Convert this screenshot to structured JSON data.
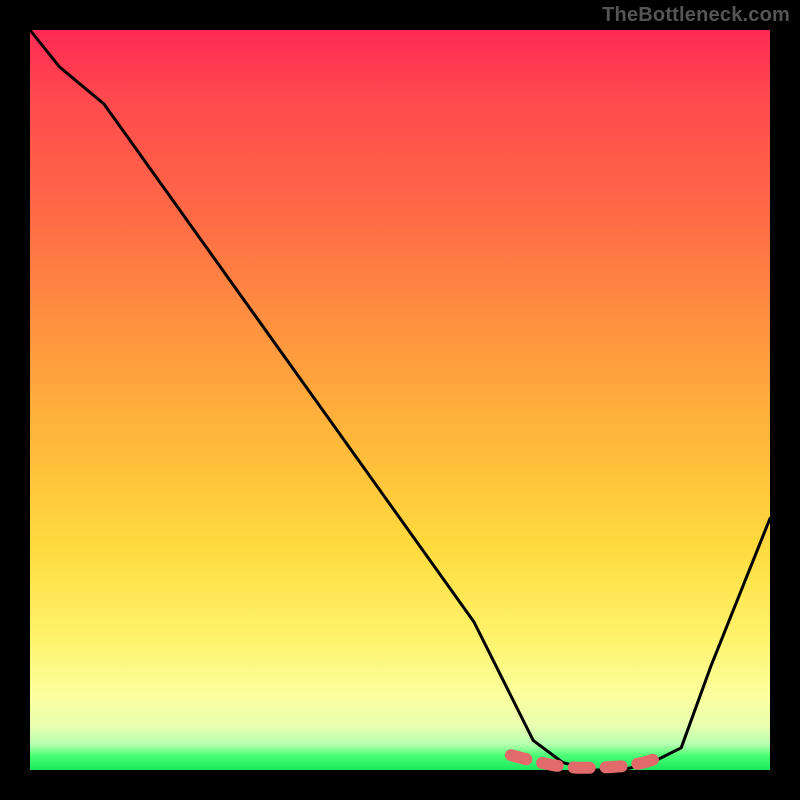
{
  "watermark": "TheBottleneck.com",
  "chart_data": {
    "type": "line",
    "title": "",
    "xlabel": "",
    "ylabel": "",
    "xlim": [
      0,
      100
    ],
    "ylim": [
      0,
      100
    ],
    "series": [
      {
        "name": "bottleneck-curve",
        "x": [
          0,
          4,
          10,
          20,
          30,
          40,
          50,
          60,
          65,
          68,
          72,
          76,
          80,
          84,
          88,
          92,
          96,
          100
        ],
        "values": [
          100,
          95,
          90,
          76,
          62,
          48,
          34,
          20,
          10,
          4,
          1,
          0,
          0,
          1,
          3,
          14,
          24,
          34
        ]
      }
    ],
    "optimum_markers": {
      "name": "optimum-band",
      "x": [
        65,
        68,
        71,
        74,
        77,
        80,
        83,
        86
      ],
      "values": [
        2.0,
        1.2,
        0.6,
        0.3,
        0.3,
        0.5,
        1.0,
        2.0
      ]
    },
    "gradient_stops": [
      {
        "pos": 0,
        "color": "#ff2a55"
      },
      {
        "pos": 0.25,
        "color": "#ff6a46"
      },
      {
        "pos": 0.55,
        "color": "#ffb73a"
      },
      {
        "pos": 0.82,
        "color": "#fff36b"
      },
      {
        "pos": 0.94,
        "color": "#e9ffb0"
      },
      {
        "pos": 1.0,
        "color": "#18e85d"
      }
    ]
  }
}
